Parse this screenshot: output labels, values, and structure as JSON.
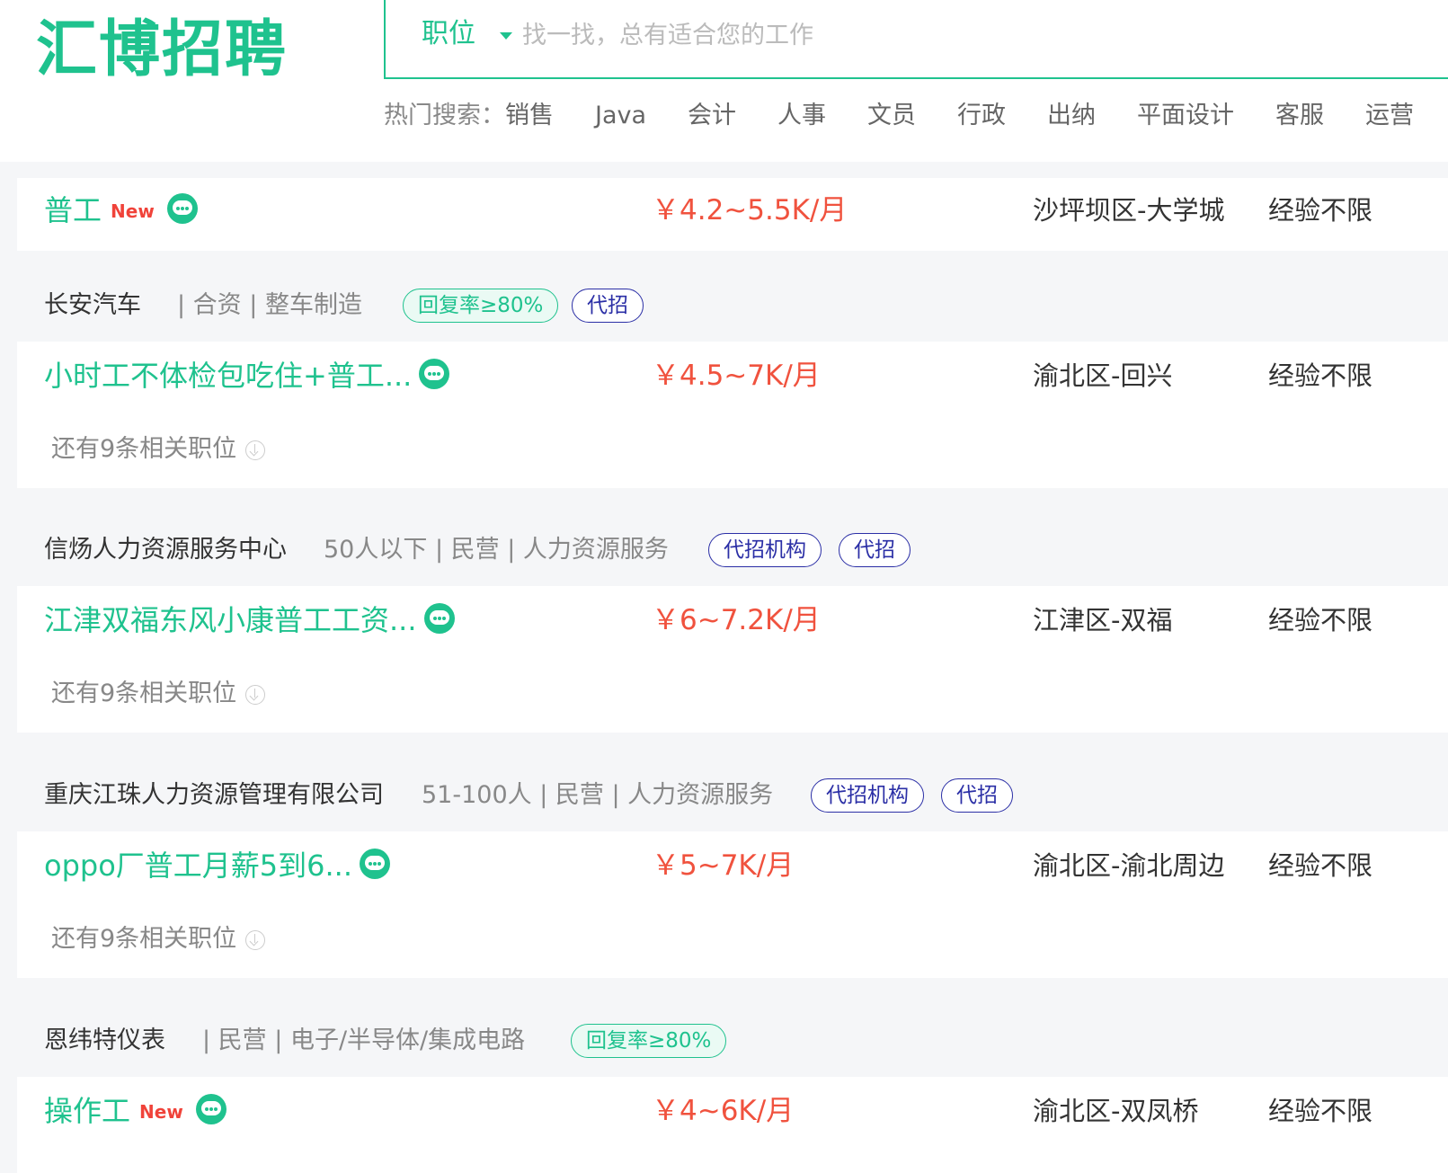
{
  "brand": {
    "logo_text": "汇博招聘",
    "accent_color": "#1fc28e",
    "salary_color": "#f0523e",
    "badge_color": "#2b2fa6"
  },
  "search": {
    "type_label": "职位",
    "placeholder": "找一找，总有适合您的工作"
  },
  "hot_search": {
    "label": "热门搜索：",
    "items": [
      "销售",
      "Java",
      "会计",
      "人事",
      "文员",
      "行政",
      "出纳",
      "平面设计",
      "客服",
      "运营"
    ]
  },
  "listings": [
    {
      "job": {
        "title": "普工",
        "new_badge": "New",
        "salary": "￥4.2~5.5K/月",
        "location": "沙坪坝区-大学城",
        "experience": "经验不限"
      }
    },
    {
      "company": {
        "name": "长安汽车",
        "meta": "| 合资 | 整车制造",
        "tags": [
          "回复率≥80%",
          "代招"
        ]
      },
      "job": {
        "title": "小时工不体检包吃住+普工...",
        "salary": "￥4.5~7K/月",
        "location": "渝北区-回兴",
        "experience": "经验不限"
      },
      "more": "还有9条相关职位"
    },
    {
      "company": {
        "name": "信炀人力资源服务中心",
        "meta": "50人以下 | 民营 | 人力资源服务",
        "tags": [
          "代招机构",
          "代招"
        ]
      },
      "job": {
        "title": "江津双福东风小康普工工资...",
        "salary": "￥6~7.2K/月",
        "location": "江津区-双福",
        "experience": "经验不限"
      },
      "more": "还有9条相关职位"
    },
    {
      "company": {
        "name": "重庆江珠人力资源管理有限公司",
        "meta": "51-100人 | 民营 | 人力资源服务",
        "tags": [
          "代招机构",
          "代招"
        ]
      },
      "job": {
        "title": "oppo厂普工月薪5到6...",
        "salary": "￥5~7K/月",
        "location": "渝北区-渝北周边",
        "experience": "经验不限"
      },
      "more": "还有9条相关职位"
    },
    {
      "company": {
        "name": "恩纬特仪表",
        "meta": "| 民营 | 电子/半导体/集成电路",
        "tags": [
          "回复率≥80%"
        ]
      },
      "job": {
        "title": "操作工",
        "new_badge": "New",
        "salary": "￥4~6K/月",
        "location": "渝北区-双凤桥",
        "experience": "经验不限"
      }
    }
  ]
}
